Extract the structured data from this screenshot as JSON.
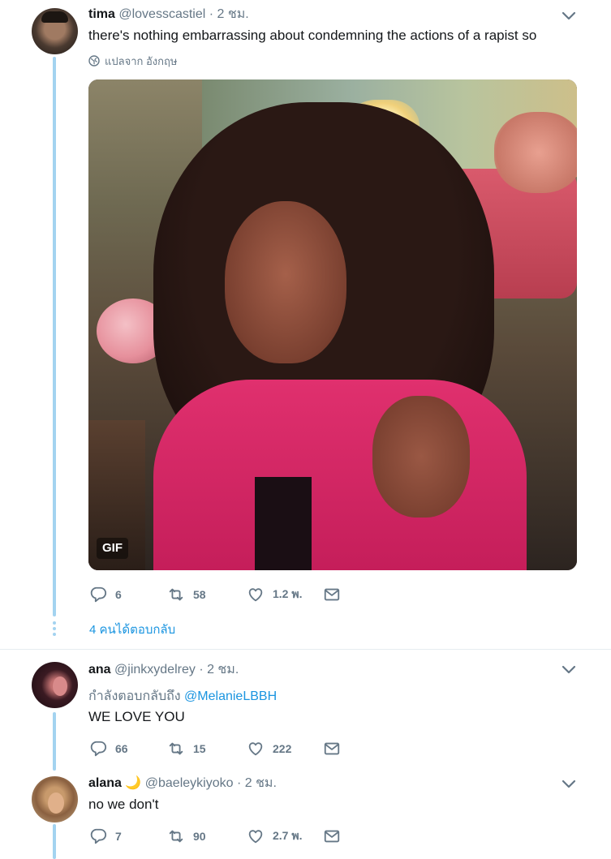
{
  "tweets": [
    {
      "name": "tima",
      "handle": "@lovesscastiel",
      "time": "· 2 ชม.",
      "text": "there's nothing embarrassing about condemning the actions of a rapist so",
      "translate": "แปลจาก อังกฤษ",
      "media_badge": "GIF",
      "counts": {
        "reply": "6",
        "retweet": "58",
        "like": "1.2 พ."
      },
      "more_replies": "4 คนได้ตอบกลับ"
    },
    {
      "name": "ana",
      "handle": "@jinkxydelrey",
      "time": "· 2 ชม.",
      "replying_prefix": "กำลังตอบกลับถึง",
      "replying_to": "@MelanieLBBH",
      "text": "WE LOVE YOU",
      "counts": {
        "reply": "66",
        "retweet": "15",
        "like": "222"
      }
    },
    {
      "name": "alana",
      "emoji": "🌙",
      "handle": "@baeleykiyoko",
      "time": "· 2 ชม.",
      "text": "no we don't",
      "counts": {
        "reply": "7",
        "retweet": "90",
        "like": "2.7 พ."
      }
    }
  ],
  "colors": {
    "accent": "#1b95e0",
    "muted": "#657786",
    "thread_line": "#a3d3f0",
    "divider": "#e6ecf0"
  }
}
